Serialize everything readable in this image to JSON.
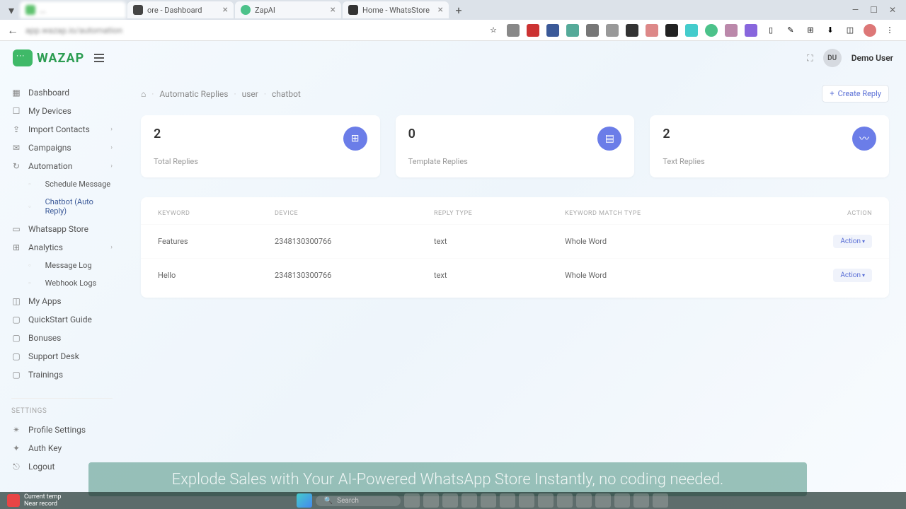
{
  "browser": {
    "tabs": [
      {
        "title": "...",
        "close": false
      },
      {
        "title": "ore - Dashboard",
        "close": true
      },
      {
        "title": "ZapAI",
        "close": true
      },
      {
        "title": "Home - WhatsStore",
        "close": true
      }
    ],
    "win": [
      "—",
      "☐",
      "✕"
    ]
  },
  "header": {
    "logo_text": "WAZAP",
    "avatar_initials": "DU",
    "username": "Demo User"
  },
  "sidebar": {
    "items": [
      {
        "label": "Dashboard",
        "icon": "▦"
      },
      {
        "label": "My Devices",
        "icon": "☐"
      },
      {
        "label": "Import Contacts",
        "icon": "⇪",
        "chev": true
      },
      {
        "label": "Campaigns",
        "icon": "✉",
        "chev": true
      },
      {
        "label": "Automation",
        "icon": "↻",
        "chev": true
      },
      {
        "label": "Schedule Message",
        "sub": true
      },
      {
        "label": "Chatbot (Auto Reply)",
        "sub": true,
        "active": true
      },
      {
        "label": "Whatsapp Store",
        "icon": "▭"
      },
      {
        "label": "Analytics",
        "icon": "⊞",
        "chev": true
      },
      {
        "label": "Message Log",
        "sub": true
      },
      {
        "label": "Webhook Logs",
        "sub": true
      },
      {
        "label": "My Apps",
        "icon": "◫"
      },
      {
        "label": "QuickStart Guide",
        "icon": "▢"
      },
      {
        "label": "Bonuses",
        "icon": "▢"
      },
      {
        "label": "Support Desk",
        "icon": "▢"
      },
      {
        "label": "Trainings",
        "icon": "▢"
      }
    ],
    "settings_label": "SETTINGS",
    "settings": [
      {
        "label": "Profile Settings",
        "icon": "✴"
      },
      {
        "label": "Auth Key",
        "icon": "✦"
      },
      {
        "label": "Logout",
        "icon": "⎋"
      }
    ]
  },
  "breadcrumb": {
    "items": [
      "Automatic Replies",
      "user",
      "chatbot"
    ]
  },
  "create_btn": "Create Reply",
  "stats": [
    {
      "value": "2",
      "label": "Total Replies",
      "icon": "⊞"
    },
    {
      "value": "0",
      "label": "Template Replies",
      "icon": "▤"
    },
    {
      "value": "2",
      "label": "Text Replies",
      "icon": "〰"
    }
  ],
  "table": {
    "headers": {
      "keyword": "KEYWORD",
      "device": "DEVICE",
      "reply": "REPLY TYPE",
      "match": "KEYWORD MATCH TYPE",
      "action": "ACTION"
    },
    "rows": [
      {
        "keyword": "Features",
        "device": "2348130300766",
        "reply": "text",
        "match": "Whole Word",
        "action": "Action"
      },
      {
        "keyword": "Hello",
        "device": "2348130300766",
        "reply": "text",
        "match": "Whole Word",
        "action": "Action"
      }
    ]
  },
  "banner": "Explode Sales with Your AI-Powered WhatsApp Store Instantly, no coding needed.",
  "taskbar": {
    "weather_line1": "Current temp",
    "weather_line2": "Near record",
    "search": "Search"
  }
}
